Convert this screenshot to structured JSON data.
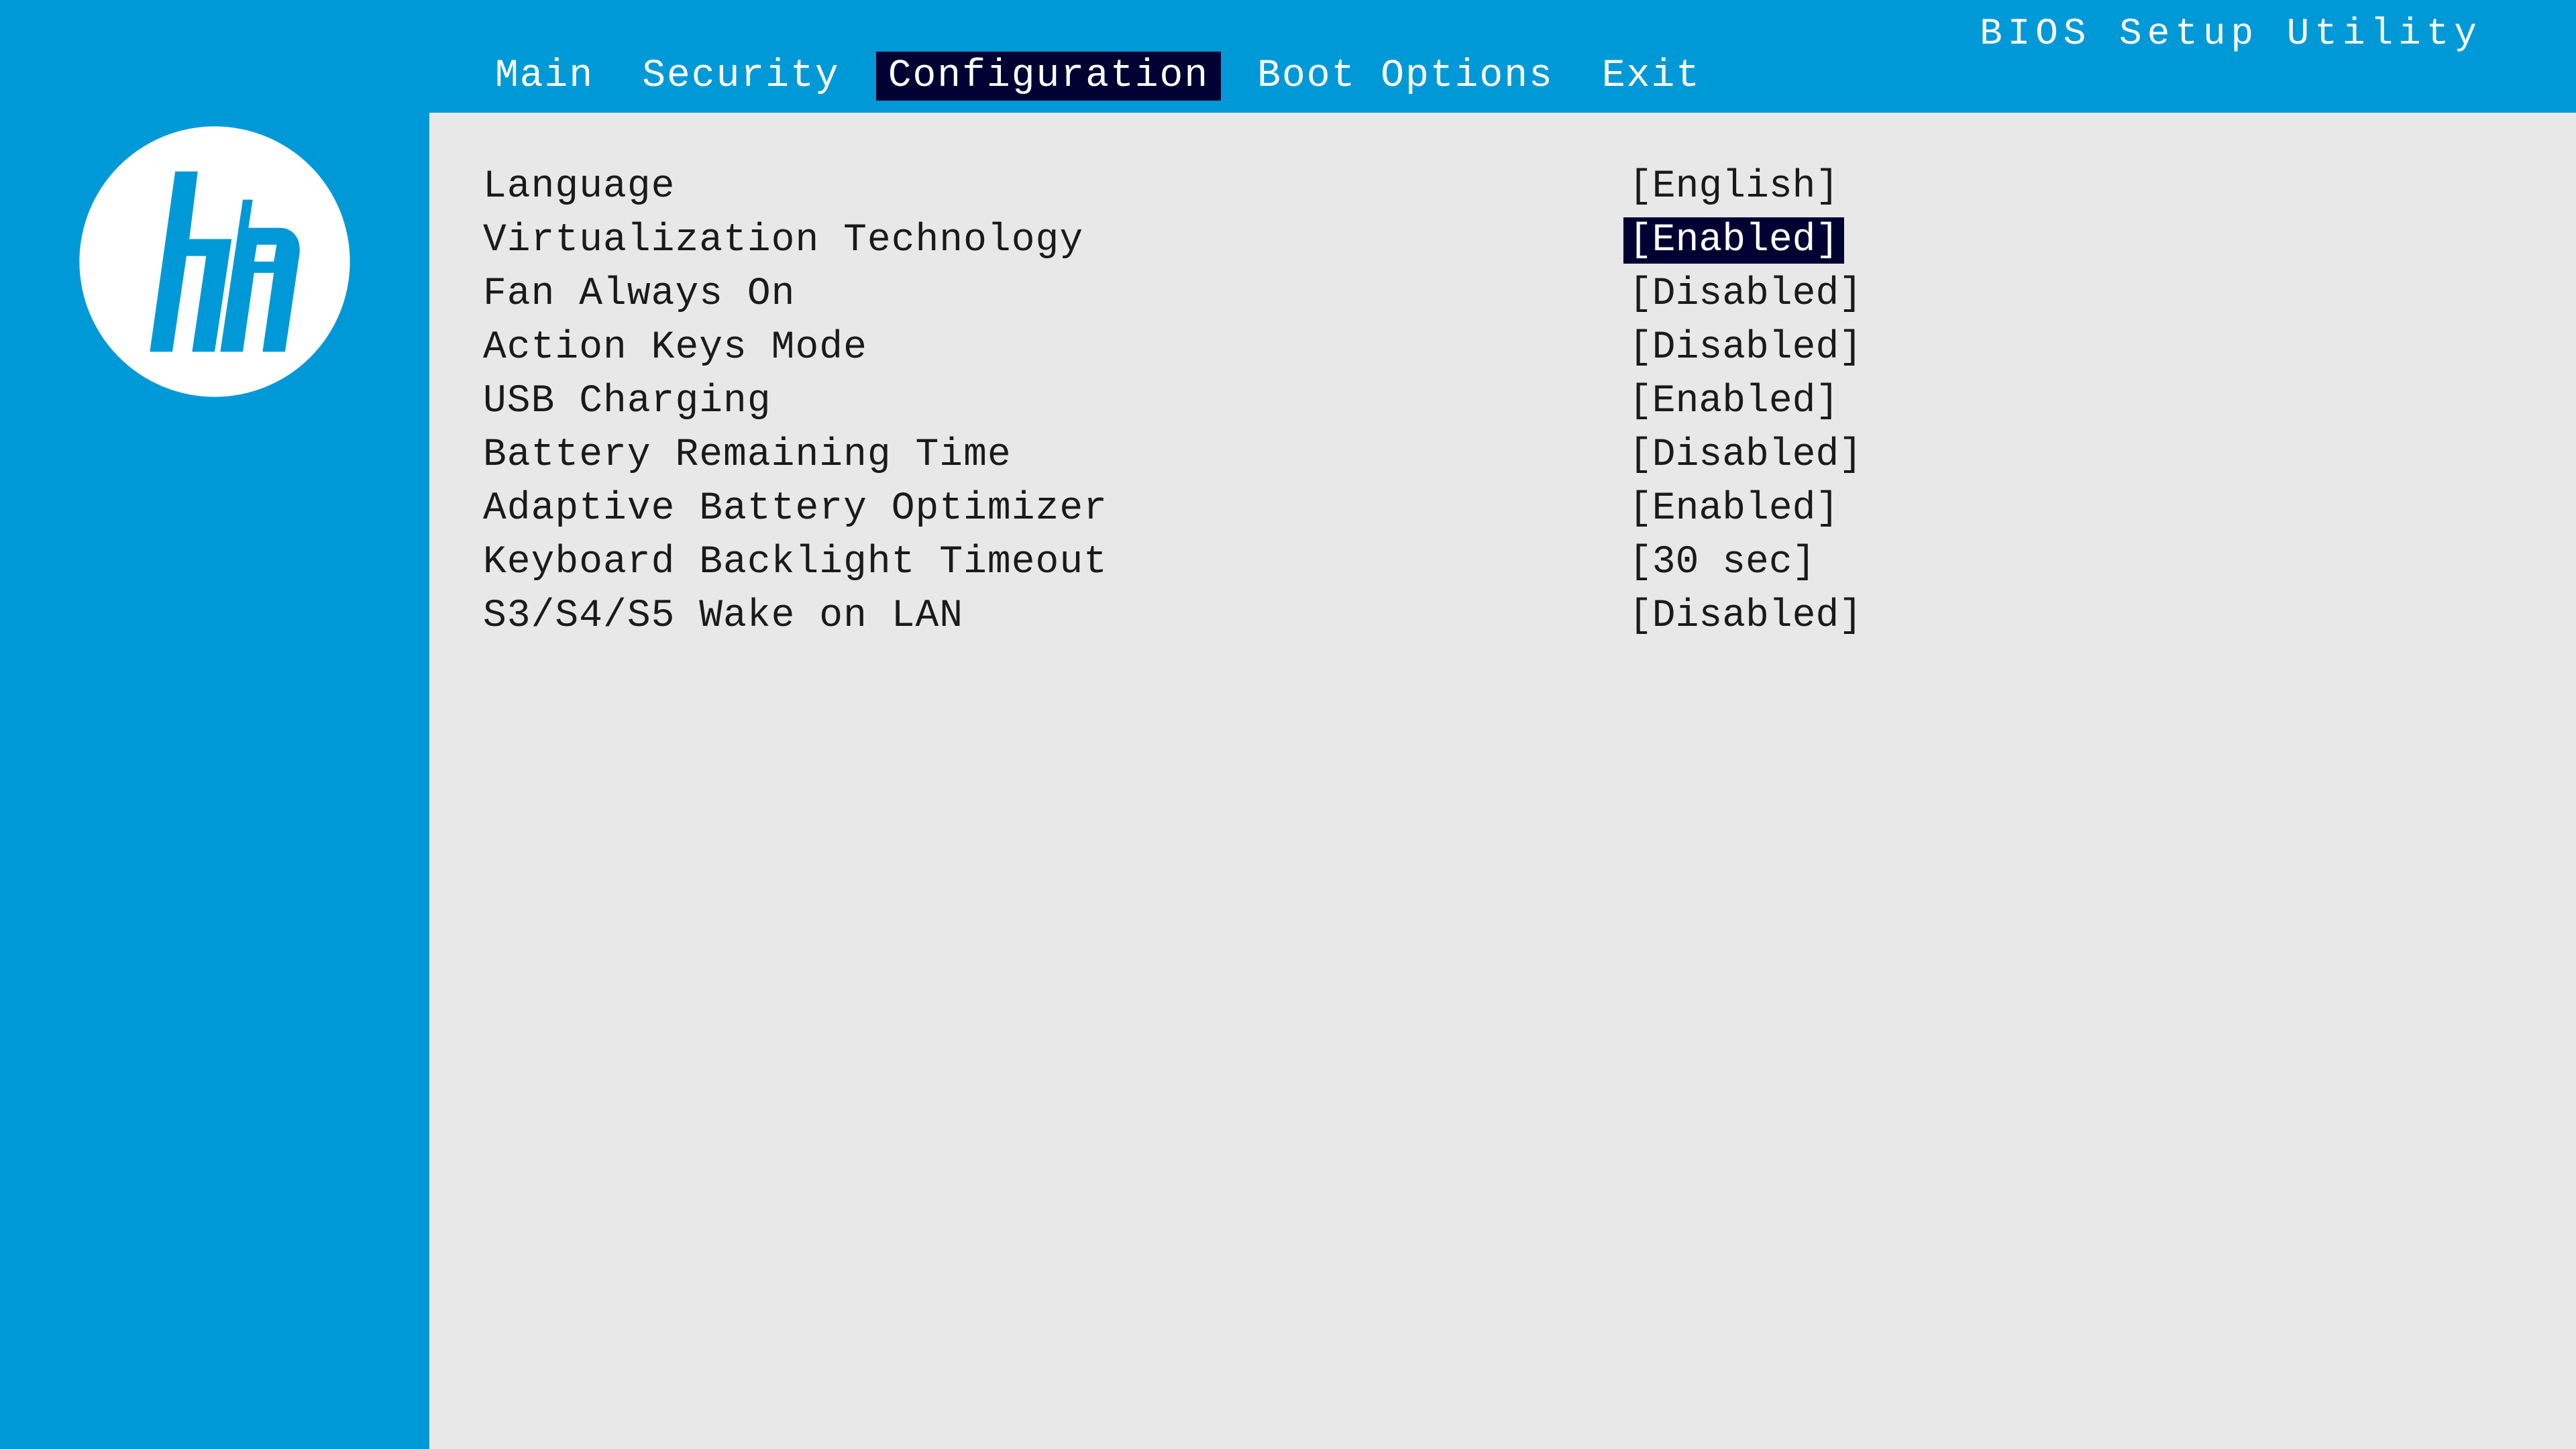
{
  "title": "BIOS Setup Utility",
  "tabs": {
    "main": "Main",
    "security": "Security",
    "configuration": "Configuration",
    "boot_options": "Boot Options",
    "exit": "Exit"
  },
  "settings": [
    {
      "label": "Language",
      "value": "[English]",
      "selected": false
    },
    {
      "label": "Virtualization Technology",
      "value": "[Enabled]",
      "selected": true
    },
    {
      "label": "Fan Always On",
      "value": "[Disabled]",
      "selected": false
    },
    {
      "label": "Action Keys Mode",
      "value": "[Disabled]",
      "selected": false
    },
    {
      "label": "USB Charging",
      "value": "[Enabled]",
      "selected": false
    },
    {
      "label": "Battery Remaining Time",
      "value": "[Disabled]",
      "selected": false
    },
    {
      "label": "Adaptive Battery Optimizer",
      "value": "[Enabled]",
      "selected": false
    },
    {
      "label": "Keyboard Backlight Timeout",
      "value": "[30 sec]",
      "selected": false
    },
    {
      "label": "S3/S4/S5 Wake on LAN",
      "value": "[Disabled]",
      "selected": false
    }
  ]
}
